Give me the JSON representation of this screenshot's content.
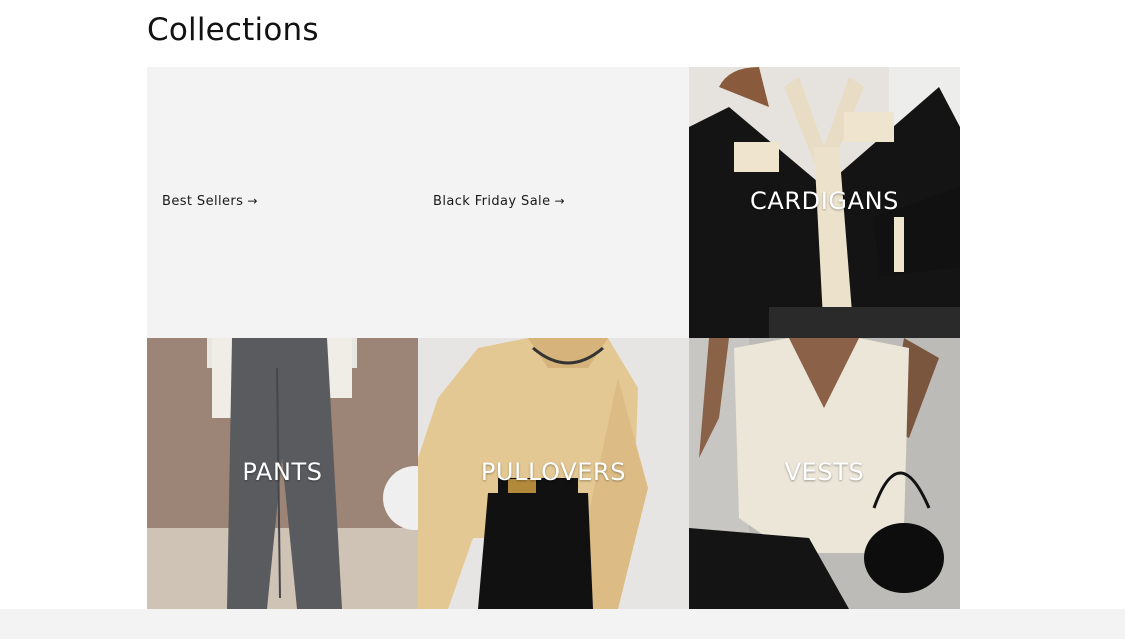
{
  "section": {
    "title": "Collections"
  },
  "collections": [
    {
      "label": "Best Sellers",
      "arrow": "→",
      "image_icon": "none"
    },
    {
      "label": "Black Friday Sale",
      "arrow": "→",
      "image_icon": "none"
    },
    {
      "label": "CARDIGANS",
      "image_icon": "cardigan-photo"
    },
    {
      "label": "PANTS",
      "image_icon": "pants-photo"
    },
    {
      "label": "PULLOVERS",
      "image_icon": "pullover-photo"
    },
    {
      "label": "VESTS",
      "image_icon": "vest-photo"
    }
  ],
  "colors": {
    "text": "#121212",
    "tile_bg": "#f3f3f3",
    "label": "#ffffff"
  }
}
